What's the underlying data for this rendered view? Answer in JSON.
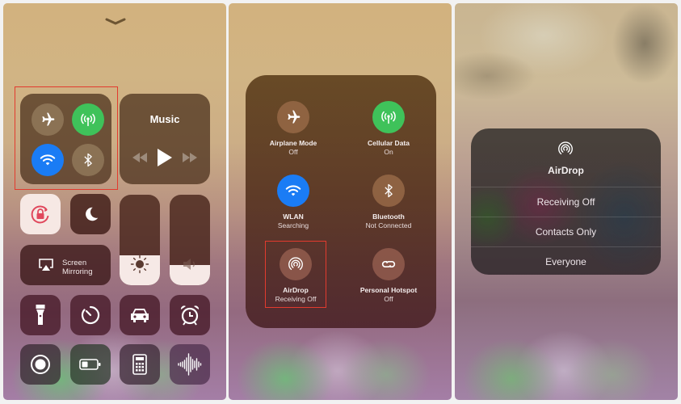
{
  "screen1": {
    "music_tile": {
      "title": "Music"
    },
    "connectivity": {
      "airplane": {
        "icon": "airplane-icon",
        "state": "off"
      },
      "cellular": {
        "icon": "cellular-antenna-icon",
        "state": "on",
        "color": "#3fc25a"
      },
      "wifi": {
        "icon": "wifi-icon",
        "state": "on",
        "color": "#1a7cf5"
      },
      "bluetooth": {
        "icon": "bluetooth-icon",
        "state": "off"
      }
    },
    "orientation_lock": {
      "icon": "rotation-lock-icon",
      "state": "on",
      "color": "#e0475c"
    },
    "do_not_disturb": {
      "icon": "moon-icon",
      "state": "off"
    },
    "screen_mirroring": {
      "line1": "Screen",
      "line2": "Mirroring"
    },
    "brightness": {
      "icon": "sun-icon",
      "level_percent": 33
    },
    "volume": {
      "icon": "speaker-icon",
      "level_percent": 22
    },
    "shortcuts": [
      {
        "icon": "flashlight-icon"
      },
      {
        "icon": "timer-icon"
      },
      {
        "icon": "car-icon"
      },
      {
        "icon": "alarm-clock-icon"
      },
      {
        "icon": "screen-record-icon"
      },
      {
        "icon": "low-power-battery-icon"
      },
      {
        "icon": "calculator-icon"
      },
      {
        "icon": "voice-memo-waveform-icon"
      }
    ],
    "highlight_color": "#e23b2e"
  },
  "screen2": {
    "toggles": [
      {
        "name": "Airplane Mode",
        "status": "Off",
        "icon": "airplane-icon"
      },
      {
        "name": "Cellular Data",
        "status": "On",
        "icon": "cellular-antenna-icon",
        "color": "#3fc25a"
      },
      {
        "name": "WLAN",
        "status": "Searching",
        "icon": "wifi-icon",
        "color": "#1a7cf5"
      },
      {
        "name": "Bluetooth",
        "status": "Not Connected",
        "icon": "bluetooth-icon"
      },
      {
        "name": "AirDrop",
        "status": "Receiving Off",
        "icon": "airdrop-icon"
      },
      {
        "name": "Personal Hotspot",
        "status": "Off",
        "icon": "hotspot-link-icon"
      }
    ]
  },
  "screen3": {
    "menu": {
      "title": "AirDrop",
      "icon": "airdrop-icon",
      "options": [
        "Receiving Off",
        "Contacts Only",
        "Everyone"
      ]
    }
  }
}
